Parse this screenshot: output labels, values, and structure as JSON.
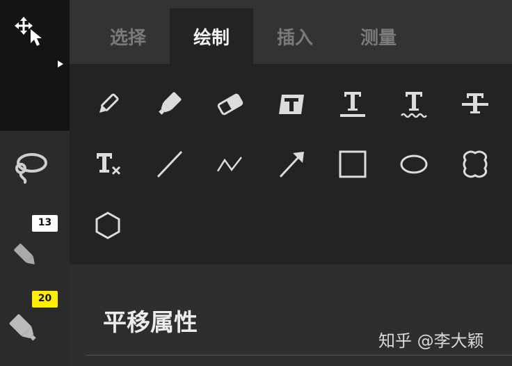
{
  "tabs": [
    {
      "label": "选择",
      "active": false
    },
    {
      "label": "绘制",
      "active": true
    },
    {
      "label": "插入",
      "active": false
    },
    {
      "label": "测量",
      "active": false
    }
  ],
  "rail": {
    "pen_badge": "13",
    "highlighter_badge": "20",
    "pen_badge_color": "#ffffff",
    "highlighter_badge_color": "#ffee00"
  },
  "tools_row1": [
    "pen-icon",
    "highlighter-icon",
    "eraser-icon",
    "text-box-icon",
    "text-underline-icon",
    "text-squiggly-icon",
    "text-strikethrough-icon"
  ],
  "tools_row2": [
    "clear-format-icon",
    "line-icon",
    "polyline-icon",
    "arrow-icon",
    "rectangle-icon",
    "ellipse-icon",
    "cloud-icon"
  ],
  "tools_row3": [
    "hexagon-icon"
  ],
  "props": {
    "title": "平移属性"
  },
  "watermark": "知乎 @李大颖"
}
